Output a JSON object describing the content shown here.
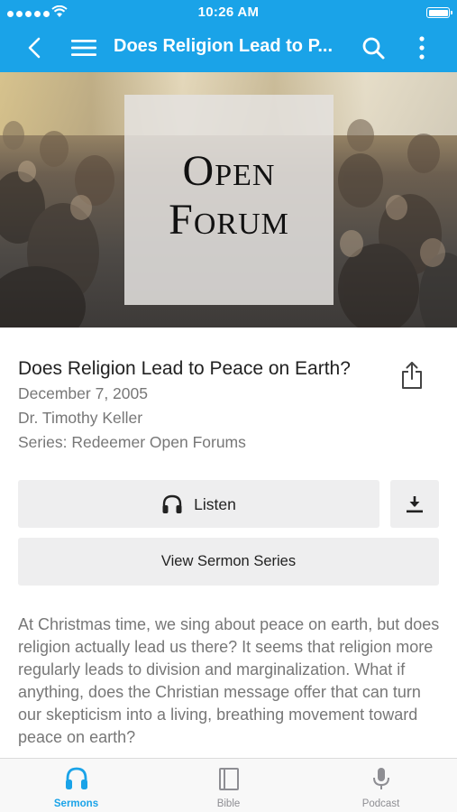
{
  "status_bar": {
    "time": "10:26 AM"
  },
  "header": {
    "title": "Does Religion Lead to P...",
    "accent": "#1aa3e8"
  },
  "banner": {
    "logo_line1": "Open",
    "logo_line2": "Forum"
  },
  "sermon": {
    "title": "Does Religion Lead to Peace on Earth?",
    "date": "December 7, 2005",
    "speaker": "Dr. Timothy Keller",
    "series": "Series: Redeemer Open Forums"
  },
  "actions": {
    "listen_label": "Listen",
    "view_series_label": "View Sermon Series"
  },
  "description": "At Christmas time, we sing about peace on earth, but does religion actually lead us there? It seems that religion more regularly leads to division and marginalization. What if anything, does the Christian message offer that can turn our skepticism into a living, breathing movement toward peace on earth?",
  "tabs": [
    {
      "label": "Sermons",
      "icon": "headphones-icon",
      "active": true
    },
    {
      "label": "Bible",
      "icon": "book-icon",
      "active": false
    },
    {
      "label": "Podcast",
      "icon": "microphone-icon",
      "active": false
    }
  ]
}
